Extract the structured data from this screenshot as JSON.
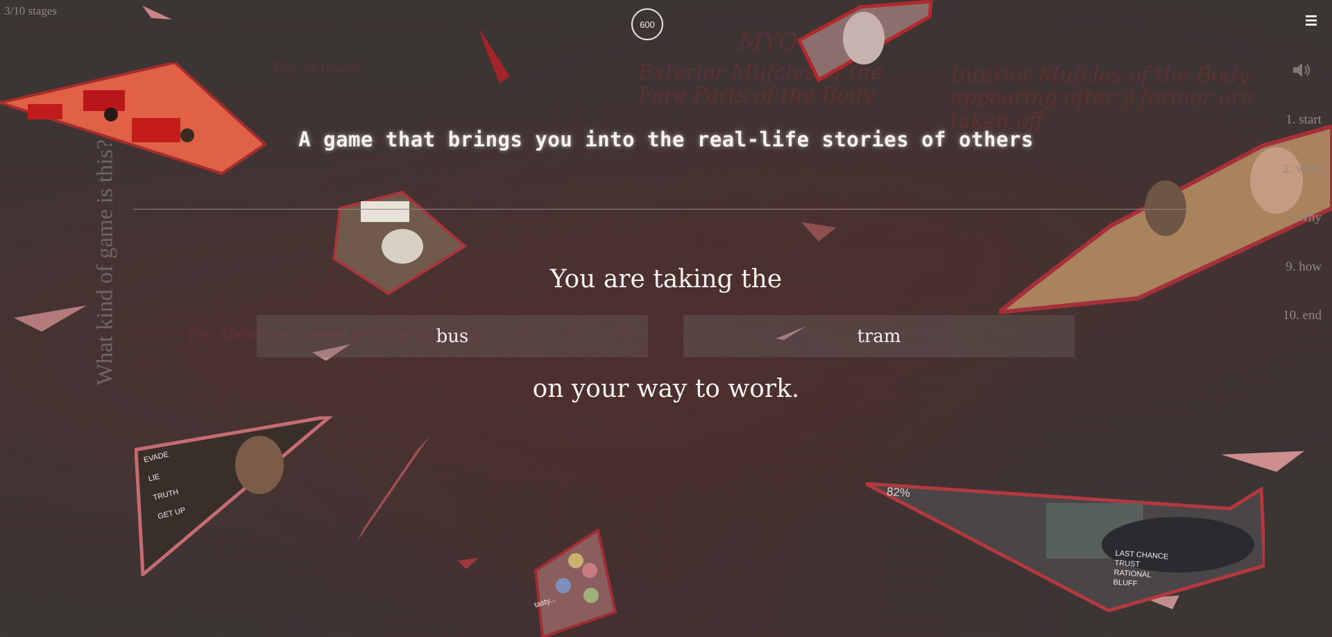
{
  "header": {
    "stage_count": "3/10 stages",
    "score": "600"
  },
  "nav": {
    "items": [
      {
        "label": "1. start"
      },
      {
        "label": "2. what"
      },
      {
        "label": "7. why"
      },
      {
        "label": "9. how"
      },
      {
        "label": "10. end"
      }
    ]
  },
  "side_question": "What kind of game is this?",
  "tagline": "A game that brings you into the real-life stories of others",
  "sentence": {
    "before": "You are taking the",
    "after": "on your way to work."
  },
  "choices": [
    {
      "label": "bus"
    },
    {
      "label": "tram"
    }
  ],
  "background_text": {
    "title": "Exterior Mufcles of the Fore Parts of the Body",
    "title2": "Interior Mufcles of the Body appearing after ÿ former are taken off",
    "heading": "MYO",
    "stomach": "The Stomach",
    "abdomen": "The Abdomen opened to Shew its parts"
  },
  "card_text": {
    "evade": "EVADE",
    "lie": "LIE",
    "truth": "TRUTH",
    "get_up": "GET UP",
    "percent": "82%",
    "last_chance": "LAST CHANCE",
    "trust": "TRUST",
    "rational": "RATIONAL",
    "bluff": "BLUFF",
    "tasty": "tasty..."
  },
  "icons": {
    "menu": "hamburger-menu-icon",
    "sound": "speaker-icon"
  },
  "colors": {
    "background": "#3b3534",
    "accent_red": "#b8232a",
    "text_light": "#f5f1ef",
    "nav_text": "#8f8886"
  }
}
